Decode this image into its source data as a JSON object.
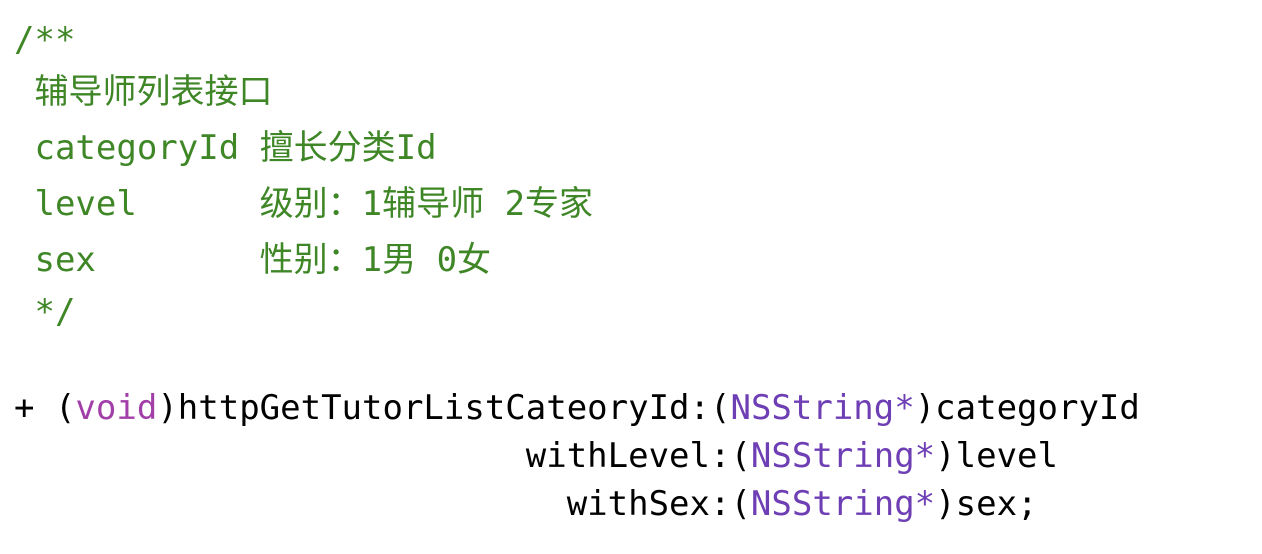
{
  "comment": {
    "open": "/**",
    "title": " 辅导师列表接口",
    "param1": " categoryId 擅长分类Id",
    "param2": " level      级别：1辅导师 2专家",
    "param3": " sex        性别：1男 0女",
    "close": " */"
  },
  "method": {
    "line1": {
      "prefix": "+ (",
      "return_type": "void",
      "name": ")httpGetTutorListCateoryId:(",
      "arg_type": "NSString*",
      "arg": ")categoryId"
    },
    "line2": {
      "indent": "                         ",
      "label": "withLevel:(",
      "arg_type": "NSString*",
      "arg": ")level"
    },
    "line3": {
      "indent": "                           ",
      "label": "withSex:(",
      "arg_type": "NSString*",
      "arg": ")sex;"
    }
  },
  "colors": {
    "comment": "#3f8627",
    "keyword": "#a23ea8",
    "type": "#6e3fb4",
    "plain": "#000000",
    "background": "#ffffff"
  }
}
